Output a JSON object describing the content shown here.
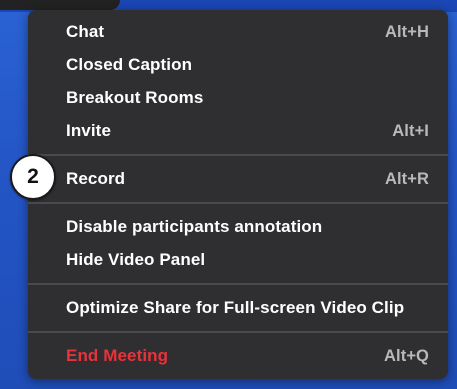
{
  "menu": {
    "items": [
      {
        "label": "Chat",
        "shortcut": "Alt+H"
      },
      {
        "label": "Closed Caption",
        "shortcut": ""
      },
      {
        "label": "Breakout Rooms",
        "shortcut": ""
      },
      {
        "label": "Invite",
        "shortcut": "Alt+I"
      },
      {
        "label": "Record",
        "shortcut": "Alt+R"
      },
      {
        "label": "Disable participants annotation",
        "shortcut": ""
      },
      {
        "label": "Hide Video Panel",
        "shortcut": ""
      },
      {
        "label": "Optimize Share for Full-screen Video Clip",
        "shortcut": ""
      },
      {
        "label": "End Meeting",
        "shortcut": "Alt+Q"
      }
    ]
  },
  "step_badge": "2",
  "colors": {
    "background": "#2456c7",
    "menu_bg": "#2f2f31",
    "divider": "#4a4a4e",
    "text": "#ffffff",
    "shortcut": "#b9b9bd",
    "danger": "#e9323a"
  }
}
